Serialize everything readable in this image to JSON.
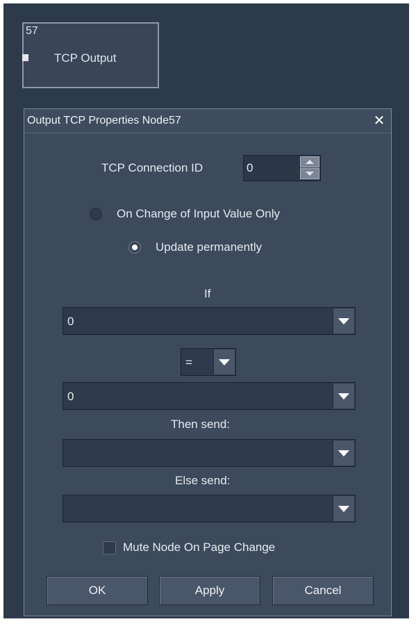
{
  "node": {
    "number": "57",
    "title": "TCP Output"
  },
  "dialog": {
    "title": "Output TCP Properties Node57",
    "close_icon": "close-icon",
    "tcp_connection_label": "TCP Connection ID",
    "tcp_connection_value": "0",
    "radio_on_change_label": "On Change of Input Value Only",
    "radio_on_change_checked": false,
    "radio_update_label": "Update permanently",
    "radio_update_checked": true,
    "if_label": "If",
    "if_value": "0",
    "operator_value": "=",
    "compare_value": "0",
    "then_label": "Then send:",
    "then_value": "",
    "else_label": "Else send:",
    "else_value": "",
    "mute_label": "Mute Node On Page Change",
    "mute_checked": false,
    "ok_label": "OK",
    "apply_label": "Apply",
    "cancel_label": "Cancel"
  }
}
